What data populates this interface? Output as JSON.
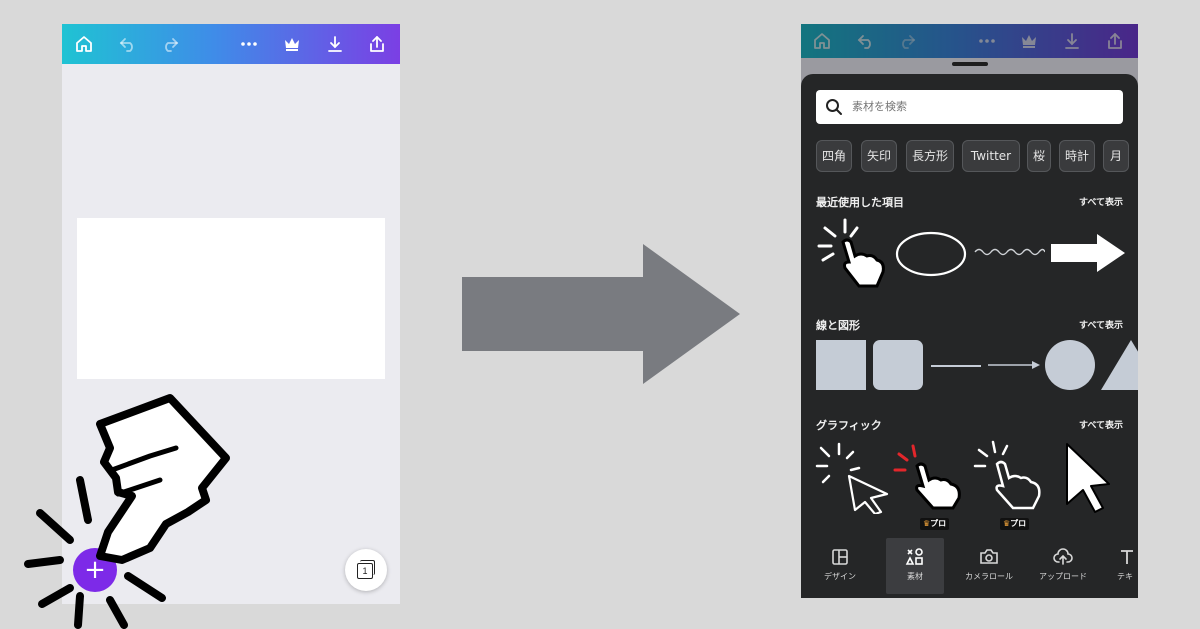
{
  "left_screen": {
    "page_count": "1",
    "add_button_symbol": "+"
  },
  "right_screen": {
    "search_placeholder": "素材を検索",
    "chips": [
      "四角",
      "矢印",
      "長方形",
      "Twitter",
      "桜",
      "時計",
      "月"
    ],
    "sections": [
      {
        "title": "最近使用した項目",
        "see_all": "すべて表示"
      },
      {
        "title": "線と図形",
        "see_all": "すべて表示"
      },
      {
        "title": "グラフィック",
        "see_all": "すべて表示"
      }
    ],
    "pro_label": "プロ",
    "bottom_nav": [
      {
        "label": "デザイン",
        "icon": "layout-icon"
      },
      {
        "label": "素材",
        "icon": "elements-icon",
        "active": true
      },
      {
        "label": "カメラロール",
        "icon": "camera-icon"
      },
      {
        "label": "アップロード",
        "icon": "upload-icon"
      },
      {
        "label": "テキ",
        "icon": "text-icon"
      }
    ]
  },
  "colors": {
    "background": "#d9d9d9",
    "gradient_start": "#1fc3d3",
    "gradient_end": "#7b3fe4",
    "add_button": "#7d2ae8",
    "arrow": "#797b80",
    "panel": "#252627",
    "shape_fill": "#c5ccd6"
  }
}
